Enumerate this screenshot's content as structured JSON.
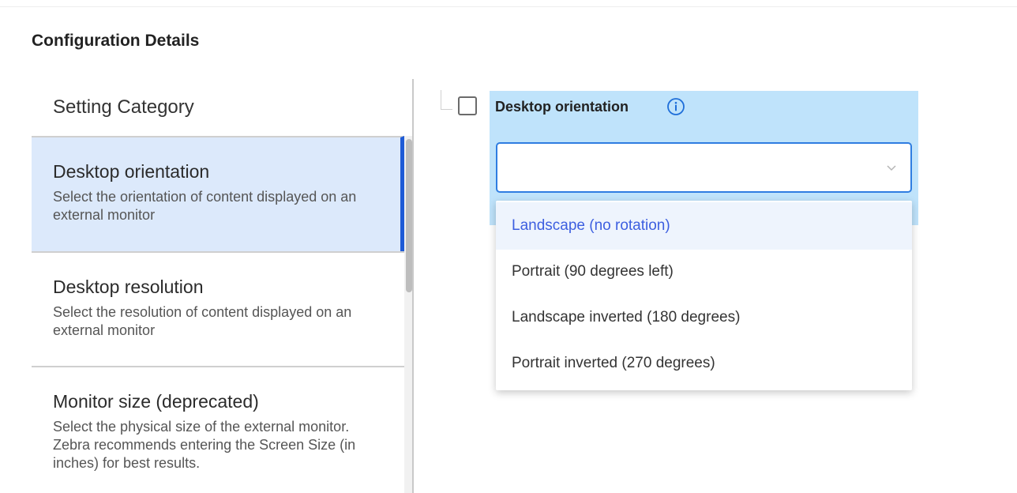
{
  "section": {
    "title": "Configuration Details"
  },
  "categories": {
    "header": "Setting Category",
    "items": [
      {
        "title": "Desktop orientation",
        "description": "Select the orientation of content displayed on an external monitor",
        "selected": true
      },
      {
        "title": "Desktop resolution",
        "description": "Select the resolution of content displayed on an external monitor",
        "selected": false
      },
      {
        "title": "Monitor size (deprecated)",
        "description": "Select the physical size of the external monitor. Zebra recommends entering the Screen Size (in inches) for best results.",
        "selected": false
      }
    ]
  },
  "setting": {
    "label": "Desktop orientation",
    "info_icon": "info-circle-icon",
    "selected_value": "",
    "checkbox_checked": false
  },
  "dropdown": {
    "highlighted_index": 0,
    "options": [
      "Landscape (no rotation)",
      "Portrait (90 degrees left)",
      "Landscape inverted (180 degrees)",
      "Portrait inverted (270 degrees)"
    ]
  },
  "colors": {
    "selected_bg": "#dce9fb",
    "selected_accent": "#1f5bd6",
    "header_bg": "#bfe3fb",
    "focus_border": "#2f7de1",
    "highlight_text": "#3d5fe0"
  }
}
